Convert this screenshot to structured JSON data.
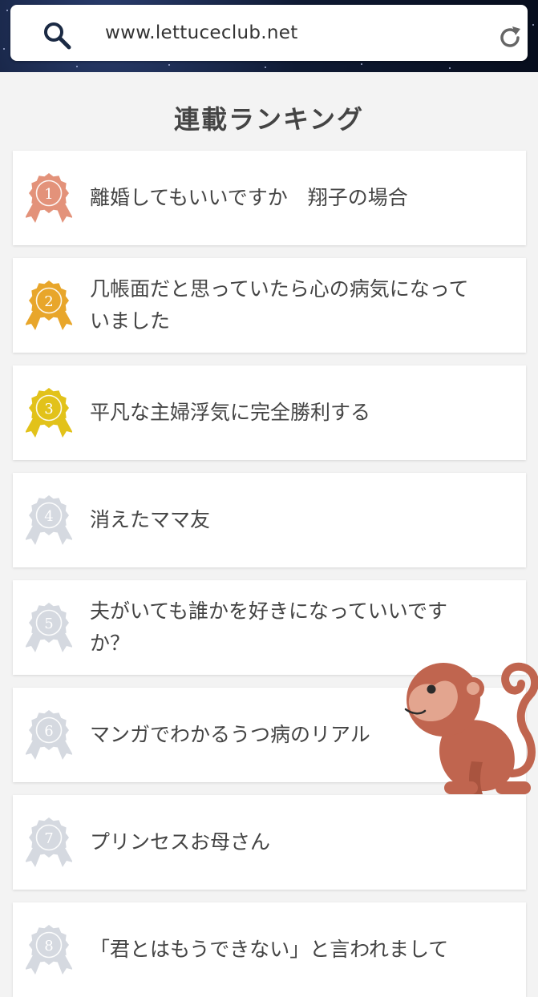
{
  "browser": {
    "url": "www.lettuceclub.net",
    "icons": {
      "search": "search-icon",
      "reload": "reload-icon"
    }
  },
  "page": {
    "title": "連載ランキング"
  },
  "ranking": [
    {
      "rank": "1",
      "title": "離婚してもいいですか　翔子の場合",
      "color": "#e3927a"
    },
    {
      "rank": "2",
      "title": "几帳面だと思っていたら心の病気になっていました",
      "color": "#e8a62b"
    },
    {
      "rank": "3",
      "title": "平凡な主婦浮気に完全勝利する",
      "color": "#e2c21a"
    },
    {
      "rank": "4",
      "title": "消えたママ友",
      "color": "#d5d9e0"
    },
    {
      "rank": "5",
      "title": "夫がいても誰かを好きになっていいですか？",
      "color": "#d5d9e0"
    },
    {
      "rank": "6",
      "title": "マンガでわかるうつ病のリアル",
      "color": "#d5d9e0"
    },
    {
      "rank": "7",
      "title": "プリンセスお母さん",
      "color": "#d5d9e0"
    },
    {
      "rank": "8",
      "title": "「君とはもうできない」と言われまして",
      "color": "#d5d9e0"
    }
  ],
  "decoration": {
    "sticker": "monkey-icon"
  }
}
